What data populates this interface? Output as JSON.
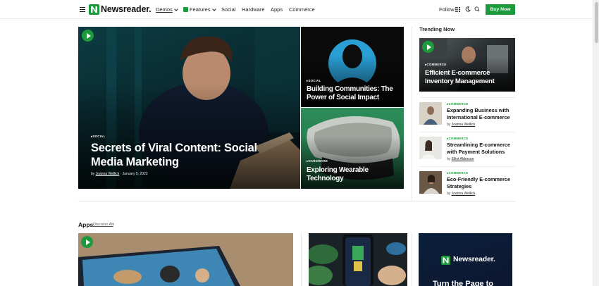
{
  "brand": {
    "name": "Newsreader.",
    "accent": "#1d9b3c"
  },
  "nav": {
    "items": [
      {
        "label": "Demos"
      },
      {
        "label": "Features"
      },
      {
        "label": "Social"
      },
      {
        "label": "Hardware"
      },
      {
        "label": "Apps"
      },
      {
        "label": "Commerce"
      }
    ],
    "follow_label": "Follow",
    "buy_label": "Buy Now"
  },
  "hero": {
    "main": {
      "category": "Social",
      "title": "Secrets of Viral Content: Social Media Marketing",
      "byline_prefix": "by",
      "author": "Joanna Wellick",
      "date": "January 5, 2023"
    },
    "top_right": {
      "category": "Social",
      "title": "Building Communities: The Power of Social Impact"
    },
    "bottom_right": {
      "category": "Hardware",
      "title": "Exploring Wearable Technology"
    }
  },
  "trending": {
    "heading": "Trending Now",
    "featured": {
      "category": "Commerce",
      "title": "Efficient E-commerce Inventory Management"
    },
    "items": [
      {
        "category": "Commerce",
        "title": "Expanding Business with International E-commerce",
        "by": "by",
        "author": "Joanna Wellick"
      },
      {
        "category": "Commerce",
        "title": "Streamlining E-commerce with Payment Solutions",
        "by": "by",
        "author": "Elliot Alderson"
      },
      {
        "category": "Commerce",
        "title": "Eco-Friendly E-commerce Strategies",
        "by": "by",
        "author": "Joanna Wellick"
      }
    ]
  },
  "apps": {
    "heading": "Apps",
    "discover_label": "Discover All",
    "ad": {
      "brand": "Newsreader.",
      "tagline": "Turn the Page to"
    }
  }
}
